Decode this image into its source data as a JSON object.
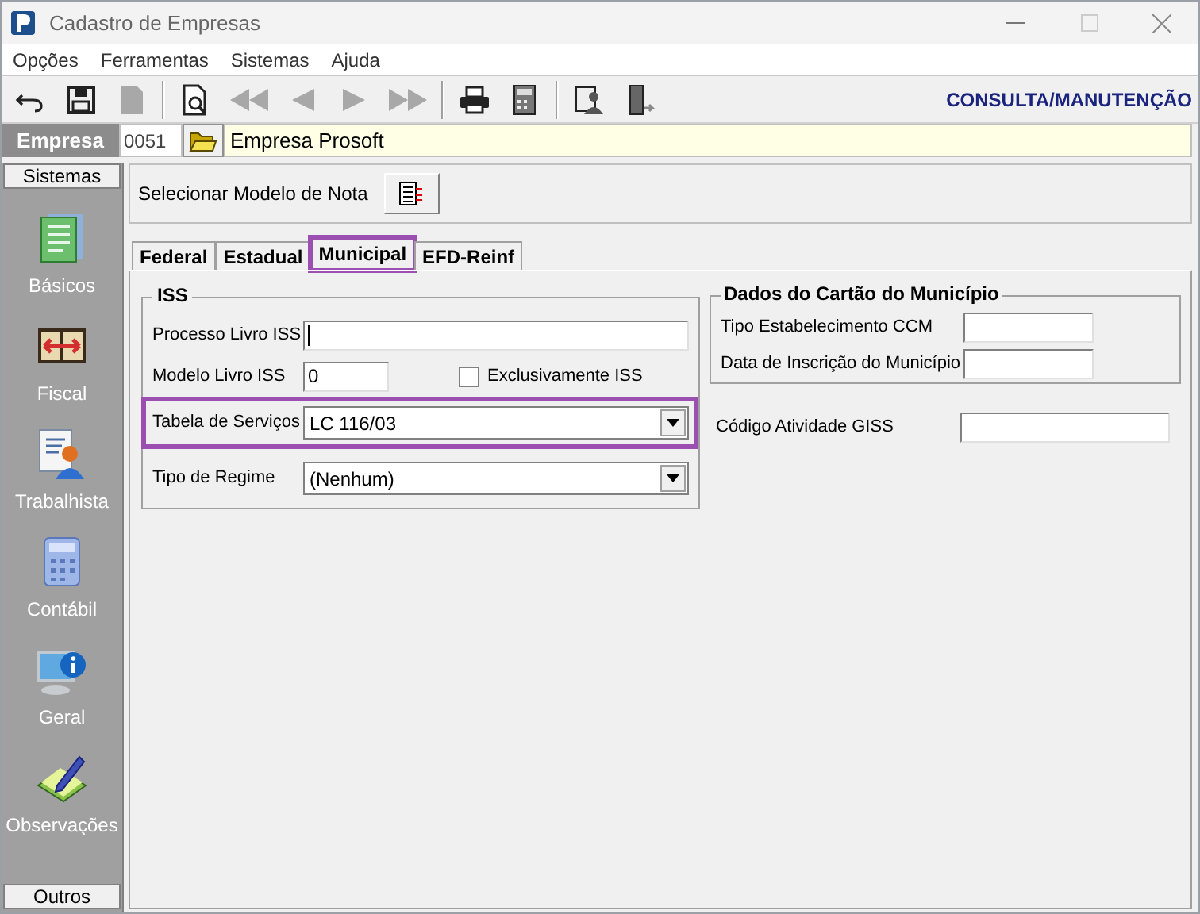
{
  "window": {
    "title": "Cadastro de Empresas"
  },
  "menu": [
    "Opções",
    "Ferramentas",
    "Sistemas",
    "Ajuda"
  ],
  "toolbar": [
    [
      {
        "kind": "undo",
        "disabled": false
      },
      {
        "kind": "save",
        "disabled": false
      },
      {
        "kind": "document",
        "disabled": true
      }
    ],
    [
      {
        "kind": "preview",
        "disabled": false
      },
      {
        "kind": "first",
        "disabled": true
      },
      {
        "kind": "prev",
        "disabled": true
      },
      {
        "kind": "next",
        "disabled": true
      },
      {
        "kind": "last",
        "disabled": true
      }
    ],
    [
      {
        "kind": "print",
        "disabled": false
      },
      {
        "kind": "calculator",
        "disabled": false
      }
    ],
    [
      {
        "kind": "person",
        "disabled": false
      },
      {
        "kind": "exit",
        "disabled": false
      }
    ]
  ],
  "mode_label": "CONSULTA/MANUTENÇÃO",
  "empresa": {
    "label": "Empresa",
    "code": "0051",
    "name": "Empresa Prosoft"
  },
  "sidebar": {
    "header": "Sistemas",
    "items": [
      {
        "kind": "document",
        "label": "Básicos"
      },
      {
        "kind": "book",
        "label": "Fiscal"
      },
      {
        "kind": "person",
        "label": "Trabalhista"
      },
      {
        "kind": "calculator",
        "label": "Contábil"
      },
      {
        "kind": "monitor",
        "label": "Geral"
      },
      {
        "kind": "pencil",
        "label": "Observações"
      }
    ],
    "footer": "Outros"
  },
  "select_model": {
    "label": "Selecionar Modelo de Nota"
  },
  "tabs": [
    {
      "label": "Federal",
      "selected": false,
      "highlighted": false
    },
    {
      "label": "Estadual",
      "selected": false,
      "highlighted": false
    },
    {
      "label": "Municipal",
      "selected": true,
      "highlighted": true
    },
    {
      "label": "EFD-Reinf",
      "selected": false,
      "highlighted": false
    }
  ],
  "iss": {
    "title": "ISS",
    "processo": {
      "label": "Processo Livro ISS"
    },
    "modelo": {
      "label": "Modelo Livro ISS",
      "value": "0"
    },
    "exclusivo": {
      "label": "Exclusivamente ISS",
      "checked": false
    },
    "tabela": {
      "label": "Tabela de Serviços",
      "value": "LC 116/03",
      "highlighted": true
    },
    "regime": {
      "label": "Tipo de Regime",
      "value": "(Nenhum)",
      "highlighted": false
    }
  },
  "cartao": {
    "title": "Dados do Cartão do Município",
    "fields": [
      {
        "label": "Tipo Estabelecimento CCM"
      },
      {
        "label": "Data de Inscrição do Município"
      }
    ]
  },
  "giss": {
    "label": "Código Atividade GISS"
  }
}
